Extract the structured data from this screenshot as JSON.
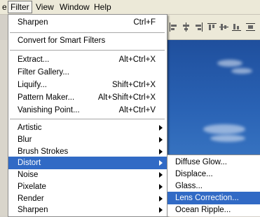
{
  "menubar": {
    "items": [
      {
        "label": "e"
      },
      {
        "label": "Filter"
      },
      {
        "label": "View"
      },
      {
        "label": "Window"
      },
      {
        "label": "Help"
      }
    ],
    "active": "Filter"
  },
  "filter_menu": {
    "sharpen": {
      "label": "Sharpen",
      "shortcut": "Ctrl+F"
    },
    "convert": {
      "label": "Convert for Smart Filters"
    },
    "extract": {
      "label": "Extract...",
      "shortcut": "Alt+Ctrl+X"
    },
    "gallery": {
      "label": "Filter Gallery..."
    },
    "liquify": {
      "label": "Liquify...",
      "shortcut": "Shift+Ctrl+X"
    },
    "pattern": {
      "label": "Pattern Maker...",
      "shortcut": "Alt+Shift+Ctrl+X"
    },
    "vanishing": {
      "label": "Vanishing Point...",
      "shortcut": "Alt+Ctrl+V"
    },
    "submenus": [
      {
        "label": "Artistic"
      },
      {
        "label": "Blur"
      },
      {
        "label": "Brush Strokes"
      },
      {
        "label": "Distort"
      },
      {
        "label": "Noise"
      },
      {
        "label": "Pixelate"
      },
      {
        "label": "Render"
      },
      {
        "label": "Sharpen"
      }
    ],
    "highlighted": "Distort"
  },
  "distort_submenu": {
    "items": [
      {
        "label": "Diffuse Glow..."
      },
      {
        "label": "Displace..."
      },
      {
        "label": "Glass..."
      },
      {
        "label": "Lens Correction..."
      },
      {
        "label": "Ocean Ripple..."
      }
    ],
    "highlighted": "Lens Correction..."
  },
  "colors": {
    "highlight": "#316ac5",
    "menubar_bg": "#ece9d8",
    "sky": "#2a63b5"
  },
  "toolbar_icons": [
    "align-left-icon",
    "align-center-icon",
    "align-right-icon",
    "align-top-icon",
    "align-middle-icon",
    "align-bottom-icon",
    "distribute-icon"
  ]
}
